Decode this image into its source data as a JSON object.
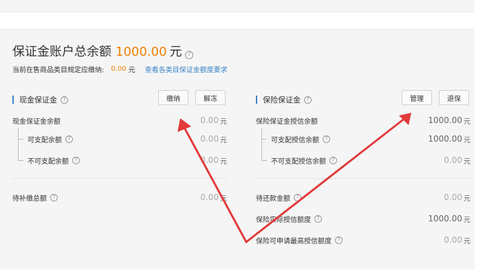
{
  "header": {
    "title": "保证金账户总余额",
    "amount": "1000.00",
    "unit": "元",
    "help_icon": "help-circle-icon"
  },
  "subline": {
    "label": "当前在售商品类目规定应缴纳:",
    "amount": "0.00",
    "unit": "元",
    "link": "查看各类目保证金额度要求"
  },
  "cash_section": {
    "title": "现金保证金",
    "buttons": {
      "pay": "缴纳",
      "unfreeze": "解冻"
    },
    "rows": [
      {
        "label": "现金保证金余额",
        "value": "0.00",
        "unit": "元",
        "help": false
      },
      {
        "label": "可支配余额",
        "value": "0.00",
        "unit": "元",
        "help": true
      },
      {
        "label": "不可支配余额",
        "value": "0.00",
        "unit": "元",
        "help": true
      },
      {
        "label": "待补缴总额",
        "value": "0.00",
        "unit": "元",
        "help": true
      }
    ]
  },
  "insurance_section": {
    "title": "保险保证金",
    "buttons": {
      "manage": "管理",
      "refund": "退保"
    },
    "rows": [
      {
        "label": "保险保证金授信余额",
        "value": "1000.00",
        "unit": "元",
        "help": false
      },
      {
        "label": "可支配授信余额",
        "value": "1000.00",
        "unit": "元",
        "help": true
      },
      {
        "label": "不可支配授信余额",
        "value": "0.00",
        "unit": "元",
        "help": true
      },
      {
        "label": "待还款金额",
        "value": "0.00",
        "unit": "元",
        "help": true
      },
      {
        "label": "保险实际授信额度",
        "value": "1000.00",
        "unit": "元",
        "help": true
      },
      {
        "label": "保险可申请最高授信额度",
        "value": "0.00",
        "unit": "元",
        "help": true
      }
    ]
  },
  "colors": {
    "accent_orange": "#f08200",
    "link_blue": "#3a84c9",
    "annotation_red": "#e23b3b",
    "panel_bg": "#f5f5f5"
  }
}
